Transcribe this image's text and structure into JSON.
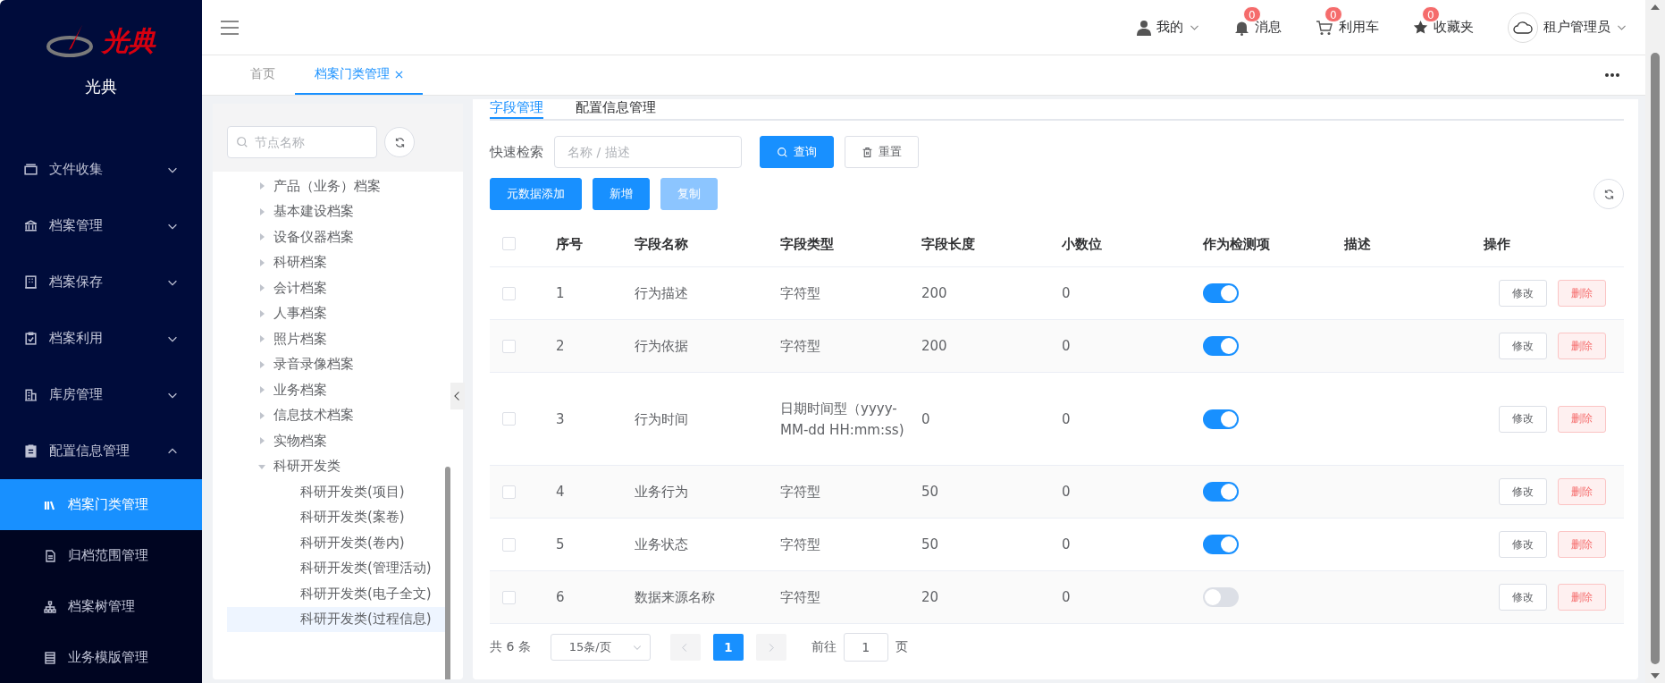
{
  "sidebar": {
    "logo_text": "光典",
    "title": "光典",
    "menu": [
      {
        "label": "文件收集",
        "expanded": false
      },
      {
        "label": "档案管理",
        "expanded": false
      },
      {
        "label": "档案保存",
        "expanded": false
      },
      {
        "label": "档案利用",
        "expanded": false
      },
      {
        "label": "库房管理",
        "expanded": false
      },
      {
        "label": "配置信息管理",
        "expanded": true,
        "children": [
          {
            "label": "档案门类管理",
            "selected": true
          },
          {
            "label": "归档范围管理",
            "selected": false
          },
          {
            "label": "档案树管理",
            "selected": false
          },
          {
            "label": "业务模版管理",
            "selected": false
          }
        ]
      }
    ]
  },
  "header": {
    "user_menu": "我的",
    "notifications": [
      {
        "label": "消息",
        "count": "0"
      },
      {
        "label": "利用车",
        "count": "0"
      },
      {
        "label": "收藏夹",
        "count": "0"
      }
    ],
    "account": "租户管理员"
  },
  "page_tabs": [
    {
      "label": "首页",
      "selected": false,
      "closable": false
    },
    {
      "label": "档案门类管理",
      "selected": true,
      "closable": true
    }
  ],
  "tree": {
    "search": {
      "placeholder": "节点名称"
    },
    "nodes": [
      {
        "label": "产品（业务）档案",
        "expanded": false,
        "selected": false
      },
      {
        "label": "基本建设档案",
        "expanded": false,
        "selected": false
      },
      {
        "label": "设备仪器档案",
        "expanded": false,
        "selected": false
      },
      {
        "label": "科研档案",
        "expanded": false,
        "selected": false
      },
      {
        "label": "会计档案",
        "expanded": false,
        "selected": false
      },
      {
        "label": "人事档案",
        "expanded": false,
        "selected": false
      },
      {
        "label": "照片档案",
        "expanded": false,
        "selected": false
      },
      {
        "label": "录音录像档案",
        "expanded": false,
        "selected": false
      },
      {
        "label": "业务档案",
        "expanded": false,
        "selected": false
      },
      {
        "label": "信息技术档案",
        "expanded": false,
        "selected": false
      },
      {
        "label": "实物档案",
        "expanded": false,
        "selected": false
      },
      {
        "label": "科研开发类",
        "expanded": true,
        "selected": false,
        "children": [
          {
            "label": "科研开发类(项目)",
            "selected": false
          },
          {
            "label": "科研开发类(案卷)",
            "selected": false
          },
          {
            "label": "科研开发类(卷内)",
            "selected": false
          },
          {
            "label": "科研开发类(管理活动)",
            "selected": false
          },
          {
            "label": "科研开发类(电子全文)",
            "selected": false
          },
          {
            "label": "科研开发类(过程信息)",
            "selected": true
          }
        ]
      }
    ]
  },
  "inner_tabs": [
    {
      "label": "字段管理",
      "selected": true
    },
    {
      "label": "配置信息管理",
      "selected": false
    }
  ],
  "filter": {
    "label": "快速检索",
    "placeholder": "名称 / 描述",
    "search_button": "查询",
    "reset_button": "重置"
  },
  "actions": [
    {
      "label": "元数据添加",
      "disabled": false
    },
    {
      "label": "新增",
      "disabled": false
    },
    {
      "label": "复制",
      "disabled": true
    }
  ],
  "table": {
    "all_checked": false,
    "columns": [
      "序号",
      "字段名称",
      "字段类型",
      "字段长度",
      "小数位",
      "作为检测项",
      "描述",
      "操作"
    ],
    "rows": [
      {
        "checked": false,
        "cells": [
          "1",
          "行为描述",
          "字符型",
          "200",
          "0"
        ],
        "detect": true,
        "edit": "修改",
        "delete": "删除"
      },
      {
        "checked": false,
        "cells": [
          "2",
          "行为依据",
          "字符型",
          "200",
          "0"
        ],
        "detect": true,
        "edit": "修改",
        "delete": "删除"
      },
      {
        "checked": false,
        "cells": [
          "3",
          "行为时间",
          "日期时间型（yyyy-MM-dd HH:mm:ss)",
          "0",
          "0"
        ],
        "detect": true,
        "edit": "修改",
        "delete": "删除"
      },
      {
        "checked": false,
        "cells": [
          "4",
          "业务行为",
          "字符型",
          "50",
          "0"
        ],
        "detect": true,
        "edit": "修改",
        "delete": "删除"
      },
      {
        "checked": false,
        "cells": [
          "5",
          "业务状态",
          "字符型",
          "50",
          "0"
        ],
        "detect": true,
        "edit": "修改",
        "delete": "删除"
      },
      {
        "checked": false,
        "cells": [
          "6",
          "数据来源名称",
          "字符型",
          "20",
          "0"
        ],
        "detect": false,
        "edit": "修改",
        "delete": "删除"
      }
    ]
  },
  "pagination": {
    "total": "共 6 条",
    "page_size": "15条/页",
    "pages": [
      {
        "label": "1",
        "selected": true
      }
    ],
    "goto_label": "前往",
    "goto_value": "1",
    "goto_suffix": "页"
  }
}
